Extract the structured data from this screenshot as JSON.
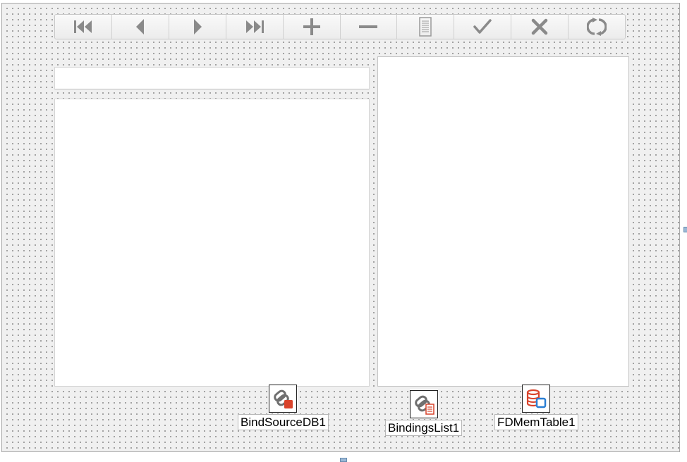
{
  "navigator": {
    "buttons": [
      {
        "id": "first",
        "icon": "skip-first-icon"
      },
      {
        "id": "prior",
        "icon": "triangle-left-icon"
      },
      {
        "id": "next",
        "icon": "triangle-right-icon"
      },
      {
        "id": "last",
        "icon": "skip-last-icon"
      },
      {
        "id": "insert",
        "icon": "plus-icon"
      },
      {
        "id": "delete",
        "icon": "minus-icon"
      },
      {
        "id": "edit",
        "icon": "document-icon"
      },
      {
        "id": "post",
        "icon": "checkmark-icon"
      },
      {
        "id": "cancel",
        "icon": "x-icon"
      },
      {
        "id": "refresh",
        "icon": "refresh-icon"
      }
    ],
    "icon_color": "#8a8a8a"
  },
  "components": {
    "bind_source": {
      "label": "BindSourceDB1",
      "icon": "chain-link-db-icon"
    },
    "bindings_list": {
      "label": "BindingsList1",
      "icon": "chain-link-list-icon"
    },
    "mem_table": {
      "label": "FDMemTable1",
      "icon": "database-table-icon"
    }
  },
  "colors": {
    "form_background": "#f0f0f0",
    "grid_dot": "#8c8c8c",
    "accent_red": "#d9432b",
    "accent_blue": "#2a7fd4"
  }
}
